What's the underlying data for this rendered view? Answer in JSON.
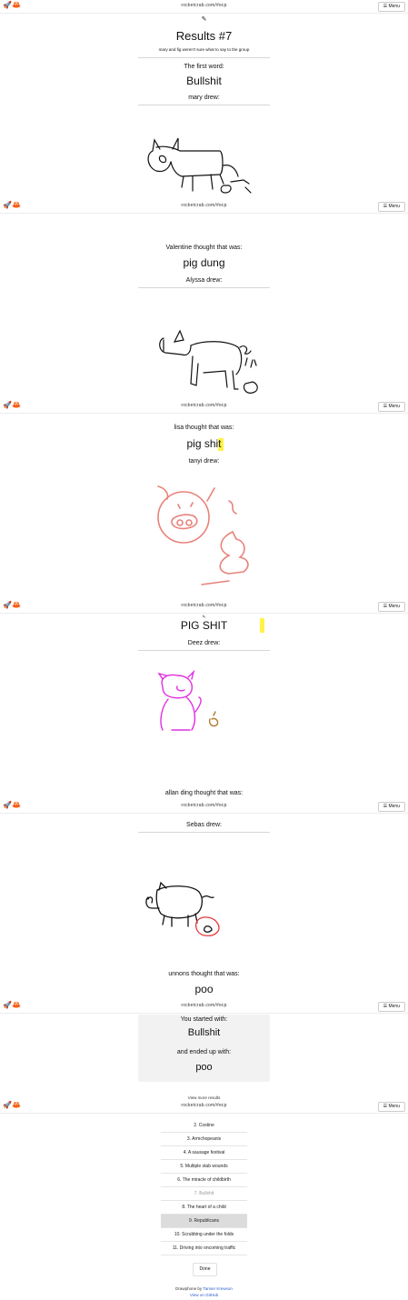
{
  "app": {
    "url": "rocketcrab.com/#ecp",
    "menu_label": "☰ Menu",
    "logo": "🚀🦀"
  },
  "results": {
    "heading": "Results #7",
    "subtitle": "mary and fig weren't sure what to say to the group",
    "first_word_label": "The first word:",
    "first_word": "Bullshit"
  },
  "steps": [
    {
      "drew_label": "mary drew:"
    },
    {
      "thought_label": "Valentine thought that was:",
      "guess": "pig dung",
      "drew_label": "Alyssa drew:"
    },
    {
      "thought_label": "lisa thought that was:",
      "guess": "pig shit",
      "drew_label": "tanyi drew:"
    },
    {
      "guess": "PIG SHIT",
      "drew_label": "Deez drew:"
    },
    {
      "thought_label": "allan ding thought that was:",
      "drew_label": "Sebas drew:"
    },
    {
      "thought_label": "unnons thought that was:",
      "guess": "poo"
    }
  ],
  "summary": {
    "started_label": "You started with:",
    "started_word": "Bullshit",
    "ended_label": "and ended up with:",
    "ended_word": "poo"
  },
  "more_results": {
    "label": "View more results",
    "items": [
      "2. Costine",
      "3. Armchopeanis",
      "4. A sausage festival",
      "5. Multiple stab wounds",
      "6. The miracle of childbirth",
      "7. Bullshit",
      "8. The heart of a child",
      "9. Republicans",
      "10. Scrubbing under the folds",
      "11. Driving into oncoming traffic"
    ],
    "selected_index": 7,
    "current_index": 5
  },
  "done_label": "Done",
  "footer": {
    "prefix": "Drawphone by",
    "author": "Tanner Krewson",
    "link": "View on GitHub"
  },
  "colors": {
    "highlight": "#fff34a",
    "drawing_black": "#111111",
    "drawing_pink": "#e8827a",
    "drawing_magenta": "#e22ee0",
    "selected_row": "#dcdcdc"
  }
}
